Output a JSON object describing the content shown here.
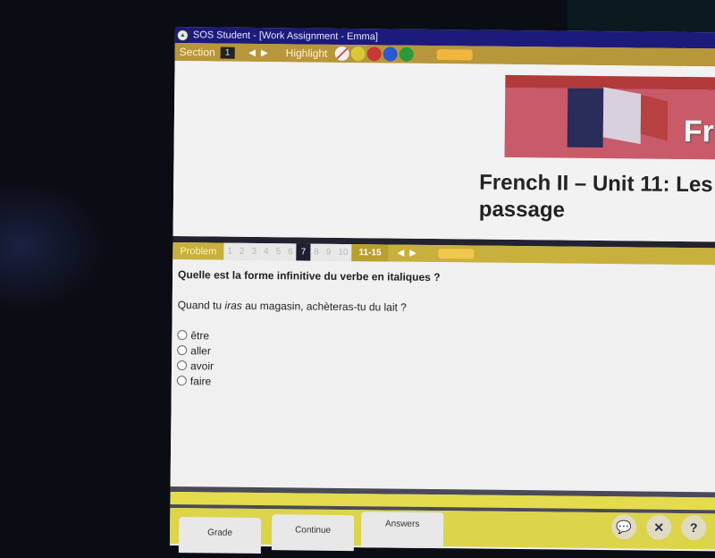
{
  "window": {
    "title": "SOS Student - [Work Assignment - Emma]"
  },
  "section_bar": {
    "label": "Section",
    "number": "1",
    "prev_icon": "triangle-left",
    "next_icon": "triangle-right",
    "highlight_label": "Highlight",
    "highlight_colors": [
      "#d8d8d8",
      "#d8c838",
      "#c83838",
      "#2a5ad0",
      "#2a9a3a"
    ]
  },
  "lesson": {
    "banner_text": "Fre",
    "title": "French II – Unit 11: Les",
    "title_line2": "passage"
  },
  "problem_bar": {
    "label": "Problem",
    "numbers": [
      "1",
      "2",
      "3",
      "4",
      "5",
      "6",
      "7",
      "8",
      "9",
      "10"
    ],
    "active": "7",
    "range": "11-15"
  },
  "question": {
    "instruction": "Quelle est la forme infinitive du verbe en italiques ?",
    "prompt_before": "Quand tu ",
    "prompt_italic": "iras",
    "prompt_after": " au magasin, achèteras-tu du lait ?",
    "options": [
      "être",
      "aller",
      "avoir",
      "faire"
    ]
  },
  "footer": {
    "buttons": [
      "Grade",
      "Continue",
      "Answers"
    ],
    "icons": [
      "chat-icon",
      "tools-icon",
      "help-icon"
    ]
  }
}
